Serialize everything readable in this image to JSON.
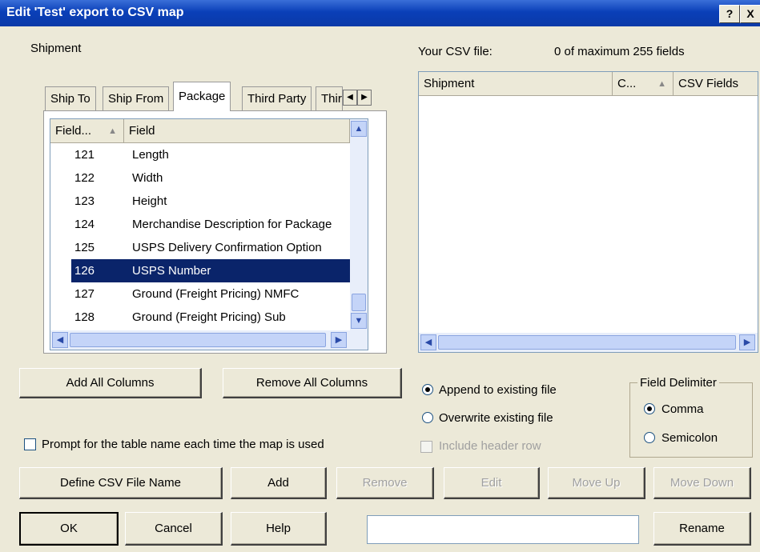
{
  "window": {
    "title": "Edit 'Test' export to CSV map",
    "help_glyph": "?",
    "close_glyph": "X"
  },
  "left": {
    "section_label": "Shipment",
    "tabs": [
      {
        "label": "Ship To"
      },
      {
        "label": "Ship From"
      },
      {
        "label": "Package",
        "active": true
      },
      {
        "label": "Third Party"
      },
      {
        "label": "Thir"
      }
    ],
    "list": {
      "columns": [
        "Field...",
        "Field"
      ],
      "rows": [
        {
          "num": "121",
          "name": "Length"
        },
        {
          "num": "122",
          "name": "Width"
        },
        {
          "num": "123",
          "name": "Height"
        },
        {
          "num": "124",
          "name": "Merchandise Description for Package"
        },
        {
          "num": "125",
          "name": "USPS Delivery Confirmation Option"
        },
        {
          "num": "126",
          "name": "USPS Number",
          "selected": true
        },
        {
          "num": "127",
          "name": "Ground (Freight Pricing) NMFC"
        },
        {
          "num": "128",
          "name": "Ground (Freight Pricing) Sub"
        }
      ]
    },
    "add_all_label": "Add All Columns",
    "remove_all_label": "Remove All Columns",
    "prompt_label": "Prompt for the table name each time the map is used"
  },
  "right": {
    "your_csv_label": "Your CSV file:",
    "field_count": "0 of maximum 255 fields",
    "columns": [
      "Shipment",
      "C...",
      "CSV Fields"
    ]
  },
  "options": {
    "append_label": "Append to existing file",
    "overwrite_label": "Overwrite existing file",
    "include_header_label": "Include header row",
    "delimiter_title": "Field Delimiter",
    "comma_label": "Comma",
    "semicolon_label": "Semicolon"
  },
  "buttons": {
    "define_csv": "Define CSV File Name",
    "add": "Add",
    "remove": "Remove",
    "edit": "Edit",
    "move_up": "Move Up",
    "move_down": "Move Down",
    "ok": "OK",
    "cancel": "Cancel",
    "help": "Help",
    "rename": "Rename"
  },
  "colors": {
    "titlebar": "#0a3fb8",
    "selection": "#0a246a",
    "dialog_bg": "#ece9d8"
  }
}
